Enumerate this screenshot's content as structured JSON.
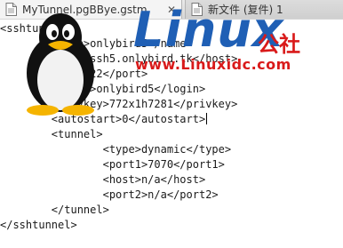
{
  "tabs": [
    {
      "label": "MyTunnel.pgBBye.gstm",
      "active": true
    },
    {
      "label": "新文件 (复件) 1",
      "active": false
    }
  ],
  "editor": {
    "lines": [
      "<sshtunnel>",
      "        <name>onlybird5</name>",
      "        <host>ssh5.onlybird.tk</host>",
      "        <port>22</port>",
      "        <login>onlybird5</login>",
      "        <privkey>772x1h7281</privkey>",
      "        <autostart>0</autostart>",
      "        <tunnel>",
      "                <type>dynamic</type>",
      "                <port1>7070</port1>",
      "                <host>n/a</host>",
      "                <port2>n/a</port2>",
      "        </tunnel>",
      "</sshtunnel>"
    ],
    "caret_line": 6
  },
  "watermark": {
    "brand": "Linux",
    "brand_cn": "公社",
    "url": "www.Linuxidc.com"
  },
  "colors": {
    "brand_blue": "#1f5fb5",
    "brand_red": "#d91a1a"
  }
}
